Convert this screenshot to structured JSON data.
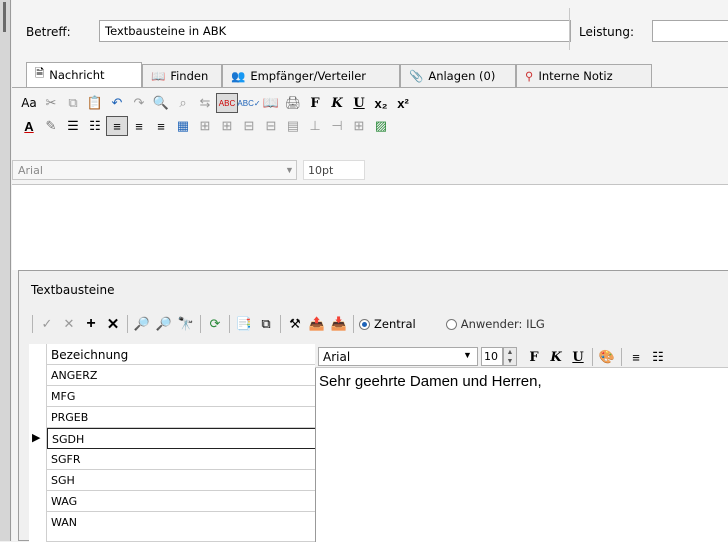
{
  "header": {
    "subject_label": "Betreff:",
    "subject_value": "Textbausteine in ABK",
    "leistung_label": "Leistung:"
  },
  "tabs": [
    {
      "label": "Nachricht",
      "icon": "document-icon"
    },
    {
      "label": "Finden",
      "icon": "book-icon"
    },
    {
      "label": "Empfänger/Verteiler",
      "icon": "recipients-icon"
    },
    {
      "label": "Anlagen (0)",
      "icon": "paperclip-icon"
    },
    {
      "label": "Interne Notiz",
      "icon": "pin-icon"
    }
  ],
  "format_bar": {
    "font_value": "Arial",
    "size_value": "10pt"
  },
  "dialog": {
    "title": "Textbausteine",
    "radio_central": "Zentral",
    "radio_user": "Anwender: ILG",
    "column_header": "Bezeichnung",
    "items": [
      "ANGERZ",
      "MFG",
      "PRGEB",
      "SGDH",
      "SGFR",
      "SGH",
      "WAG",
      "WAN"
    ],
    "selected_item": "SGDH",
    "font_value": "Arial",
    "size_value": "10",
    "preview_text": "Sehr geehrte Damen und Herren,"
  },
  "colors": {
    "accent": "#1e63b8",
    "window_bg": "#f0f0f0"
  }
}
